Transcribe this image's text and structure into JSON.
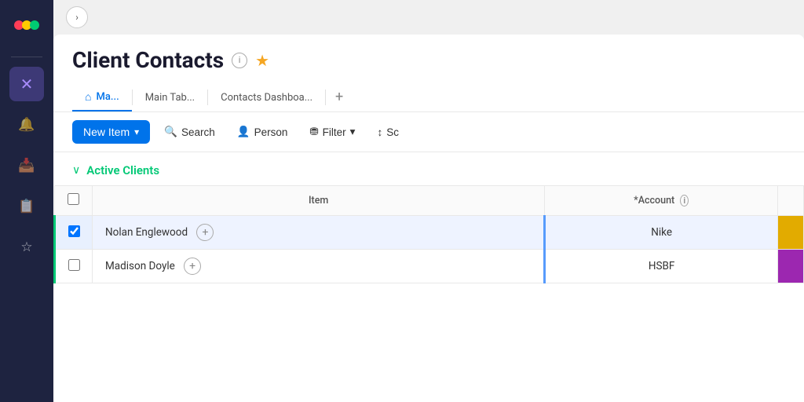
{
  "sidebar": {
    "logo_label": "monday",
    "items": [
      {
        "id": "apps",
        "icon": "⣿",
        "label": "Apps",
        "active": true
      },
      {
        "id": "notifications",
        "icon": "🔔",
        "label": "Notifications",
        "active": false
      },
      {
        "id": "inbox",
        "icon": "📥",
        "label": "Inbox",
        "active": false
      },
      {
        "id": "tasks",
        "icon": "📋",
        "label": "My Tasks",
        "active": false
      },
      {
        "id": "favorites",
        "icon": "☆",
        "label": "Favorites",
        "active": false
      }
    ]
  },
  "header": {
    "back_button_label": "›",
    "page_title": "Client Contacts",
    "info_icon_label": "ℹ",
    "star_icon_label": "★",
    "tabs": [
      {
        "id": "main",
        "label": "Ma...",
        "icon": "⌂",
        "active": true
      },
      {
        "id": "main-table",
        "label": "Main Tab...",
        "active": false
      },
      {
        "id": "contacts-dashboard",
        "label": "Contacts Dashboa...",
        "active": false
      }
    ],
    "add_tab_label": "+"
  },
  "toolbar": {
    "new_item_label": "New Item",
    "new_item_chevron": "▾",
    "search_label": "Search",
    "person_label": "Person",
    "filter_label": "Filter",
    "filter_chevron": "▾",
    "sort_label": "Sc"
  },
  "table": {
    "section_title": "Active Clients",
    "section_chevron": "∨",
    "columns": [
      {
        "id": "checkbox",
        "label": ""
      },
      {
        "id": "item",
        "label": "Item"
      },
      {
        "id": "account",
        "label": "*Account",
        "info": true
      }
    ],
    "rows": [
      {
        "id": 1,
        "name": "Nolan Englewood",
        "account": "Nike",
        "color": "yellow",
        "selected": true
      },
      {
        "id": 2,
        "name": "Madison Doyle",
        "account": "HSBF",
        "color": "purple",
        "selected": false
      }
    ]
  },
  "colors": {
    "accent_blue": "#0073ea",
    "active_green": "#00c875",
    "sidebar_bg": "#1e2340",
    "yellow_tag": "#e2ab00",
    "purple_tag": "#9c27b0",
    "orange_tag": "#ff5722"
  }
}
